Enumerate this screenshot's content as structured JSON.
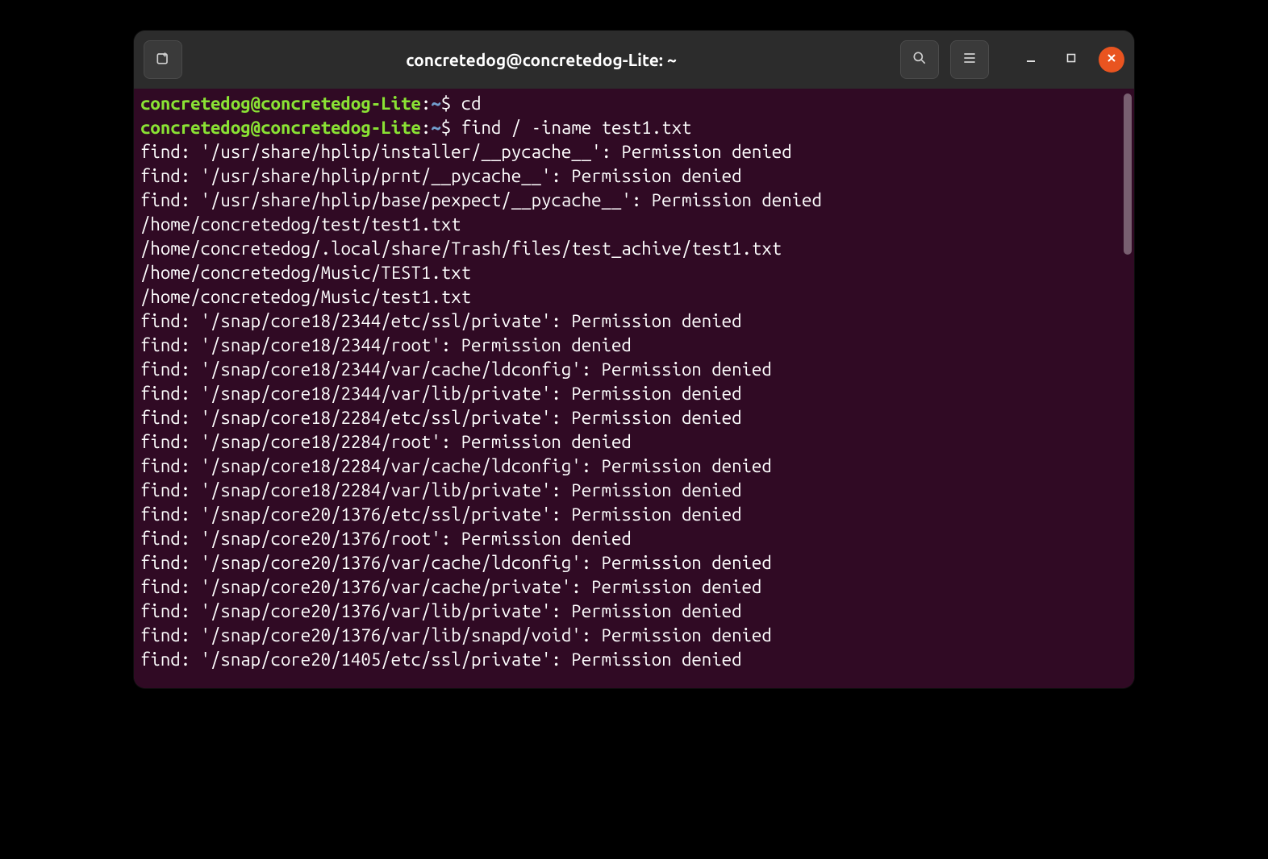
{
  "window": {
    "title": "concretedog@concretedog-Lite: ~"
  },
  "prompt": {
    "user_host": "concretedog@concretedog-Lite",
    "path": "~",
    "sep": ":",
    "dollar": "$"
  },
  "commands": [
    {
      "cmd": "cd"
    },
    {
      "cmd": "find / -iname test1.txt"
    }
  ],
  "output": [
    "find: '/usr/share/hplip/installer/__pycache__': Permission denied",
    "find: '/usr/share/hplip/prnt/__pycache__': Permission denied",
    "find: '/usr/share/hplip/base/pexpect/__pycache__': Permission denied",
    "/home/concretedog/test/test1.txt",
    "/home/concretedog/.local/share/Trash/files/test_achive/test1.txt",
    "/home/concretedog/Music/TEST1.txt",
    "/home/concretedog/Music/test1.txt",
    "find: '/snap/core18/2344/etc/ssl/private': Permission denied",
    "find: '/snap/core18/2344/root': Permission denied",
    "find: '/snap/core18/2344/var/cache/ldconfig': Permission denied",
    "find: '/snap/core18/2344/var/lib/private': Permission denied",
    "find: '/snap/core18/2284/etc/ssl/private': Permission denied",
    "find: '/snap/core18/2284/root': Permission denied",
    "find: '/snap/core18/2284/var/cache/ldconfig': Permission denied",
    "find: '/snap/core18/2284/var/lib/private': Permission denied",
    "find: '/snap/core20/1376/etc/ssl/private': Permission denied",
    "find: '/snap/core20/1376/root': Permission denied",
    "find: '/snap/core20/1376/var/cache/ldconfig': Permission denied",
    "find: '/snap/core20/1376/var/cache/private': Permission denied",
    "find: '/snap/core20/1376/var/lib/private': Permission denied",
    "find: '/snap/core20/1376/var/lib/snapd/void': Permission denied",
    "find: '/snap/core20/1405/etc/ssl/private': Permission denied"
  ]
}
